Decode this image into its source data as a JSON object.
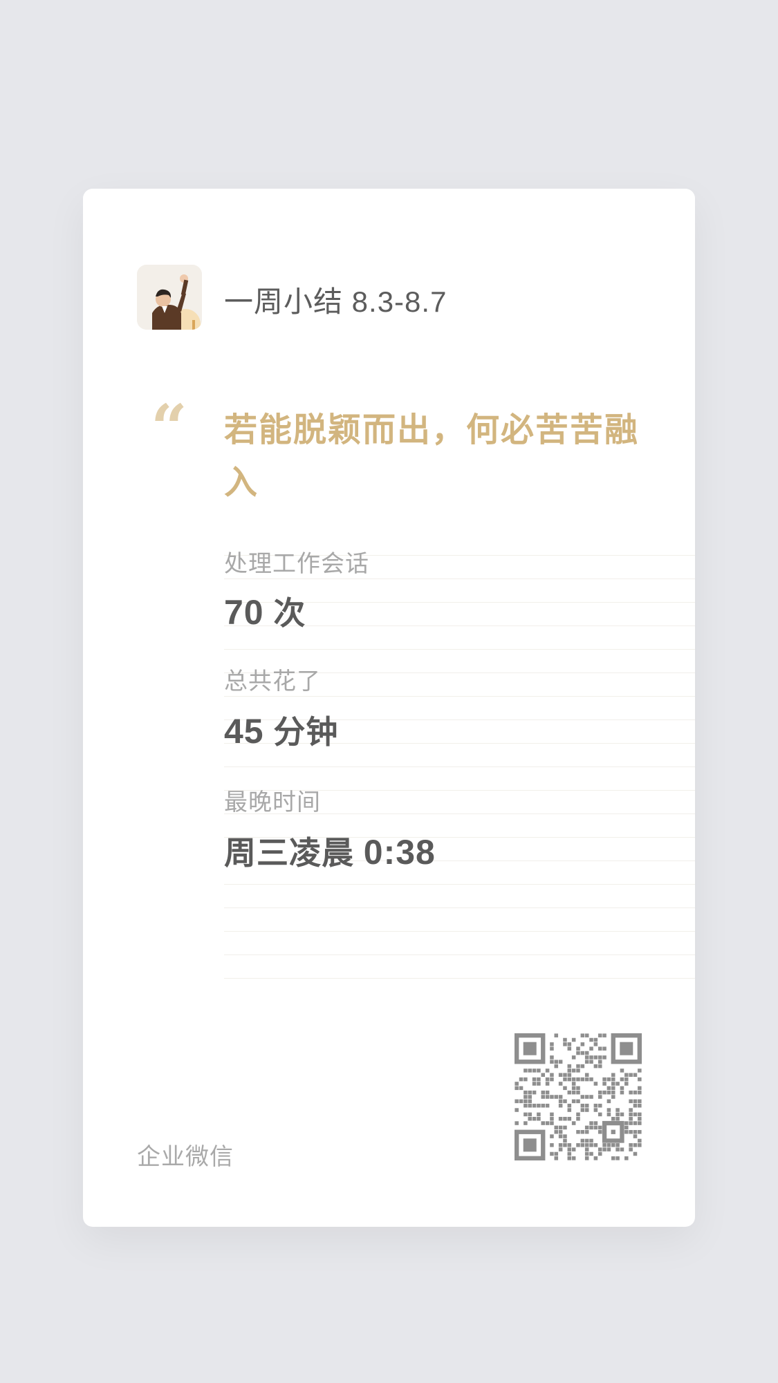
{
  "header": {
    "avatar_icon": "user-avatar-photo",
    "title": "一周小结 8.3-8.7"
  },
  "quote": {
    "mark": "❝",
    "text": "若能脱颖而出，何必苦苦融入",
    "color": "#d2b57f"
  },
  "stats": [
    {
      "label": "处理工作会话",
      "value": "70",
      "unit": "次"
    },
    {
      "label": "总共花了",
      "value": "45",
      "unit": "分钟"
    },
    {
      "label": "最晚时间",
      "value": "0:38",
      "prefix": "周三凌晨"
    }
  ],
  "footer": {
    "brand": "企业微信",
    "qr_icon": "qr-code-icon"
  }
}
